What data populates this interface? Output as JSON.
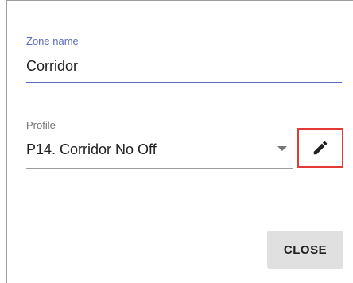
{
  "zone": {
    "label": "Zone name",
    "value": "Corridor"
  },
  "profile": {
    "label": "Profile",
    "selected": "P14. Corridor No Off"
  },
  "edit_button": {
    "icon": "pencil-icon"
  },
  "actions": {
    "close_label": "CLOSE"
  },
  "colors": {
    "accent": "#5c6bc0",
    "highlight_border": "#e53935",
    "button_bg": "#e0e0e0"
  }
}
